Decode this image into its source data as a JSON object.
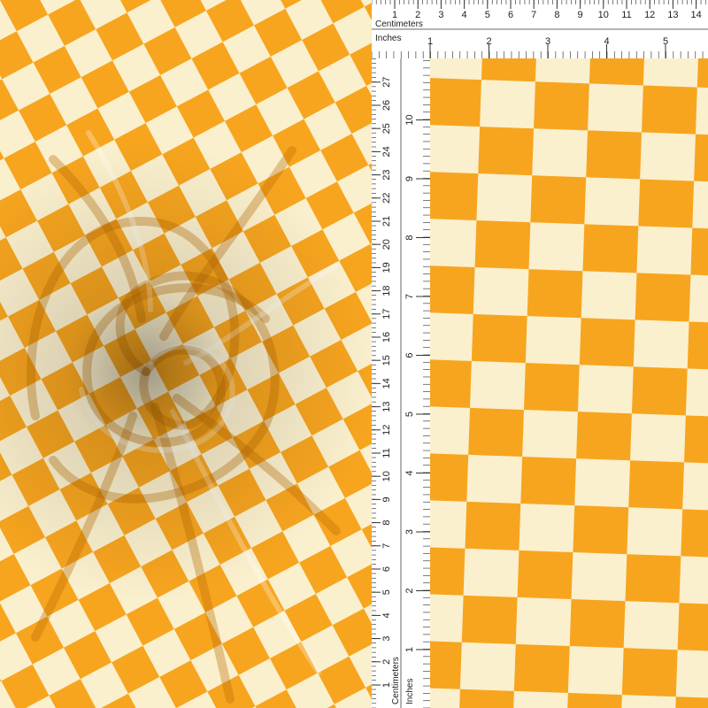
{
  "fabric": {
    "pattern": "checkerboard",
    "colors": {
      "orange": "#f7a51f",
      "cream": "#fbf0cd"
    }
  },
  "ruler_top": {
    "label_cm": "Centimeters",
    "label_in": "Inches",
    "cm_ticks": [
      "1",
      "2",
      "3",
      "4",
      "5",
      "6",
      "7",
      "8",
      "9",
      "10",
      "11",
      "12",
      "13",
      "14"
    ],
    "in_ticks": [
      "1",
      "2",
      "3",
      "4",
      "5"
    ]
  },
  "ruler_left": {
    "label_cm": "Centimeters",
    "label_in": "Inches",
    "cm_ticks": [
      "1",
      "2",
      "3",
      "4",
      "5",
      "6",
      "7",
      "8",
      "9",
      "10",
      "11",
      "12",
      "13",
      "14",
      "15",
      "16",
      "17",
      "18",
      "19",
      "20",
      "21",
      "22",
      "23",
      "24",
      "25",
      "26",
      "27"
    ],
    "in_ticks": [
      "1",
      "2",
      "3",
      "4",
      "5",
      "6",
      "7",
      "8",
      "9",
      "10"
    ]
  }
}
